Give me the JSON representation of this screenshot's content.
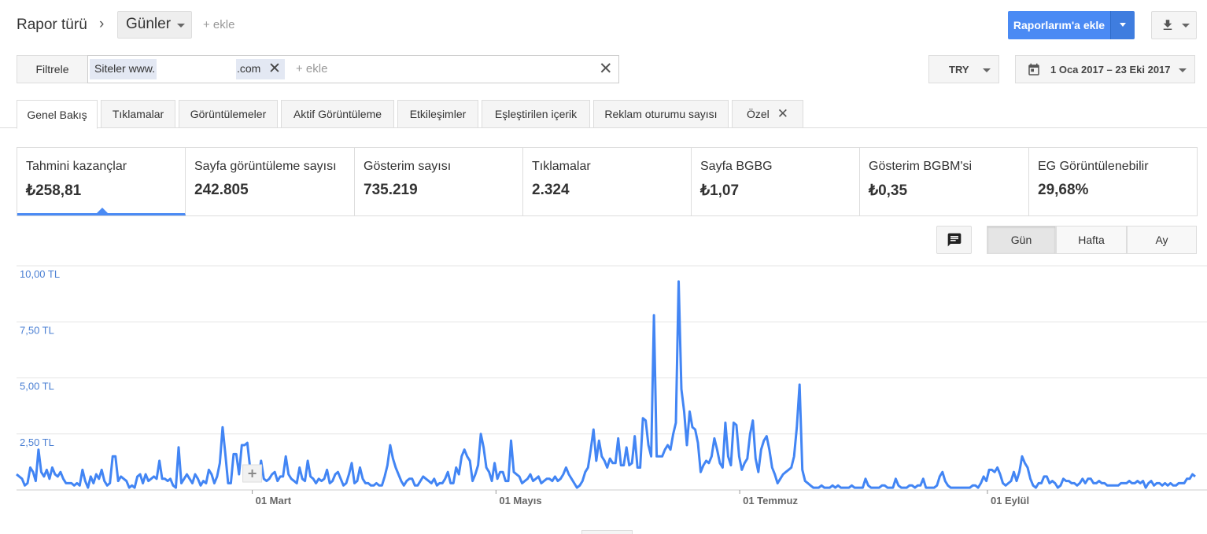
{
  "header": {
    "report_type_label": "Rapor türü",
    "dimension_value": "Günler",
    "add_dimension": "+ ekle",
    "add_to_reports": "Raporlarım'a ekle"
  },
  "filter_bar": {
    "filter_button": "Filtrele",
    "chip_prefix": "Siteler www.",
    "chip_suffix": ".com",
    "add_placeholder": "+ ekle",
    "currency": "TRY",
    "date_range": "1 Oca 2017 – 23 Eki 2017"
  },
  "tabs": [
    {
      "label": "Genel Bakış",
      "active": true
    },
    {
      "label": "Tıklamalar"
    },
    {
      "label": "Görüntülemeler"
    },
    {
      "label": "Aktif Görüntüleme"
    },
    {
      "label": "Etkileşimler"
    },
    {
      "label": "Eşleştirilen içerik"
    },
    {
      "label": "Reklam oturumu sayısı"
    },
    {
      "label": "Özel",
      "closable": true
    }
  ],
  "scorecards": [
    {
      "label": "Tahmini kazançlar",
      "value": "₺258,81",
      "active": true
    },
    {
      "label": "Sayfa görüntüleme sayısı",
      "value": "242.805"
    },
    {
      "label": "Gösterim sayısı",
      "value": "735.219"
    },
    {
      "label": "Tıklamalar",
      "value": "2.324"
    },
    {
      "label": "Sayfa BGBG",
      "value": "₺1,07"
    },
    {
      "label": "Gösterim BGBM'si",
      "value": "₺0,35"
    },
    {
      "label": "EG Görüntülenebilir",
      "value": "29,68%"
    }
  ],
  "granularity": {
    "day": "Gün",
    "week": "Hafta",
    "month": "Ay",
    "selected": "Gün"
  },
  "icons": {
    "annotation": "comment-icon",
    "download": "download-icon",
    "calendar": "calendar-icon",
    "chip_close": "close-icon",
    "clear": "close-icon"
  },
  "colors": {
    "accent": "#4a8af4",
    "line": "#4285f4",
    "axis_label": "#4a7fd3"
  },
  "chart_data": {
    "type": "line",
    "series": [
      {
        "values": [
          0.7,
          0.6,
          0.5,
          0.2,
          0.3,
          1.0,
          0.8,
          0.4,
          1.8,
          0.8,
          0.6,
          0.9,
          0.5,
          1.0,
          0.7,
          0.6,
          0.8,
          0.5,
          0.3,
          0.3,
          0.3,
          0.2,
          0.3,
          0.2,
          0.9,
          0.4,
          0.1,
          0.6,
          0.3,
          0.7,
          0.5,
          0.9,
          0.4,
          0.2,
          0.3,
          1.5,
          1.5,
          0.4,
          0.6,
          0.5,
          0.4,
          0.1,
          0.2,
          0.1,
          0.6,
          0.7,
          0.3,
          0.7,
          0.4,
          0.5,
          0.6,
          0.5,
          1.3,
          0.5,
          0.5,
          0.4,
          0.5,
          0.2,
          0.1,
          1.9,
          0.3,
          0.5,
          0.7,
          0.5,
          0.3,
          0.7,
          0.5,
          0.2,
          0.4,
          0.3,
          0.9,
          0.7,
          0.3,
          0.6,
          1.2,
          2.8,
          1.6,
          0.3,
          0.3,
          1.6,
          1.6,
          0.7,
          2.0,
          2.0,
          2.1,
          1.0,
          0.6,
          0.5,
          0.5,
          1.3,
          0.5,
          0.4,
          0.5,
          0.7,
          0.8,
          0.4,
          0.6,
          0.6,
          1.5,
          0.7,
          0.5,
          0.4,
          0.3,
          1.0,
          0.5,
          0.4,
          1.3,
          0.6,
          0.5,
          0.3,
          0.5,
          0.4,
          0.5,
          0.9,
          0.3,
          0.4,
          0.7,
          0.8,
          0.5,
          0.2,
          0.3,
          0.7,
          1.2,
          0.3,
          0.4,
          1.0,
          0.5,
          0.3,
          0.3,
          0.2,
          0.2,
          0.3,
          0.2,
          0.2,
          0.6,
          1.1,
          2.0,
          1.4,
          1.0,
          0.7,
          0.4,
          0.2,
          0.4,
          0.5,
          0.5,
          0.2,
          0.2,
          0.4,
          0.6,
          0.5,
          0.4,
          0.3,
          0.5,
          0.2,
          0.3,
          0.3,
          0.5,
          0.8,
          0.3,
          0.3,
          1.0,
          0.7,
          1.5,
          1.8,
          1.5,
          1.3,
          0.4,
          0.7,
          1.1,
          2.5,
          1.9,
          1.0,
          0.8,
          0.4,
          1.2,
          0.5,
          0.8,
          0.8,
          0.4,
          0.4,
          2.2,
          0.8,
          0.7,
          0.6,
          0.3,
          0.4,
          0.5,
          0.7,
          0.4,
          0.5,
          0.6,
          0.3,
          0.4,
          0.5,
          0.5,
          0.4,
          0.6,
          0.4,
          0.5,
          0.7,
          1.0,
          0.7,
          0.5,
          0.3,
          0.1,
          0.2,
          0.4,
          0.8,
          1.0,
          1.8,
          2.7,
          1.3,
          2.2,
          1.5,
          1.3,
          1.0,
          1.4,
          1.2,
          1.2,
          2.3,
          1.1,
          1.1,
          1.9,
          1.1,
          1.2,
          2.4,
          1.0,
          1.0,
          3.2,
          3.1,
          2.0,
          1.5,
          7.8,
          1.5,
          1.5,
          1.5,
          1.8,
          2.0,
          1.8,
          2.5,
          3.0,
          9.3,
          4.5,
          3.5,
          2.0,
          3.5,
          2.8,
          2.7,
          2.1,
          0.8,
          1.1,
          1.3,
          1.2,
          1.5,
          2.3,
          1.8,
          1.2,
          1.0,
          3.0,
          1.5,
          1.1,
          3.0,
          2.9,
          1.5,
          0.9,
          1.2,
          1.4,
          2.5,
          3.1,
          1.4,
          0.8,
          1.8,
          2.2,
          2.4,
          1.8,
          1.0,
          0.7,
          0.3,
          0.5,
          0.7,
          0.8,
          0.9,
          1.0,
          1.5,
          2.8,
          4.7,
          0.9,
          0.4,
          0.3,
          0.2,
          0.1,
          0.1,
          0.1,
          0.2,
          0.1,
          0.1,
          0.1,
          0.2,
          0.1,
          0.2,
          0.1,
          0.1,
          0.1,
          0.1,
          0.2,
          0.1,
          0.1,
          0.1,
          0.1,
          0.5,
          0.2,
          0.1,
          0.1,
          0.1,
          0.1,
          0.2,
          0.2,
          0.1,
          0.1,
          0.1,
          0.5,
          0.2,
          0.1,
          0.1,
          0.1,
          0.2,
          0.2,
          0.1,
          0.2,
          0.2,
          0.5,
          0.1,
          0.1,
          0.1,
          0.1,
          0.2,
          0.6,
          0.8,
          0.4,
          0.2,
          0.1,
          0.1,
          0.1,
          0.1,
          0.1,
          0.1,
          0.1,
          0.1,
          0.2,
          0.2,
          0.1,
          0.3,
          0.6,
          0.4,
          0.9,
          0.9,
          0.8,
          1.0,
          0.7,
          0.3,
          0.2,
          0.3,
          0.4,
          0.8,
          0.4,
          0.8,
          1.5,
          1.2,
          1.0,
          0.5,
          0.2,
          0.1,
          0.3,
          0.3,
          0.6,
          0.6,
          0.3,
          0.4,
          0.3,
          0.1,
          0.2,
          0.5,
          0.4,
          0.4,
          0.3,
          0.3,
          0.2,
          0.3,
          0.5,
          0.3,
          0.5,
          0.5,
          0.3,
          0.3,
          0.4,
          0.3,
          0.3,
          0.2,
          0.2,
          0.2,
          0.2,
          0.2,
          0.3,
          0.3,
          0.3,
          0.4,
          0.3,
          0.3,
          0.4,
          0.3,
          0.4,
          0.1,
          0.3,
          0.4,
          0.2,
          0.3,
          0.3,
          0.2,
          0.3,
          0.2,
          0.3,
          0.2,
          0.2,
          0.3,
          0.3,
          0.3,
          0.5,
          0.5,
          0.7,
          0.6
        ]
      }
    ],
    "x_ticks": [
      "01 Mart",
      "01 Mayıs",
      "01 Temmuz",
      "01 Eylül"
    ],
    "x_tick_positions": [
      59,
      120,
      181,
      243
    ],
    "y_ticks": [
      "2,50 TL",
      "5,00 TL",
      "7,50 TL",
      "10,00 TL"
    ],
    "y_tick_values": [
      2.5,
      5.0,
      7.5,
      10.0
    ],
    "ylim": [
      0,
      10
    ],
    "xlim_days": [
      0,
      295
    ],
    "grid": true
  }
}
